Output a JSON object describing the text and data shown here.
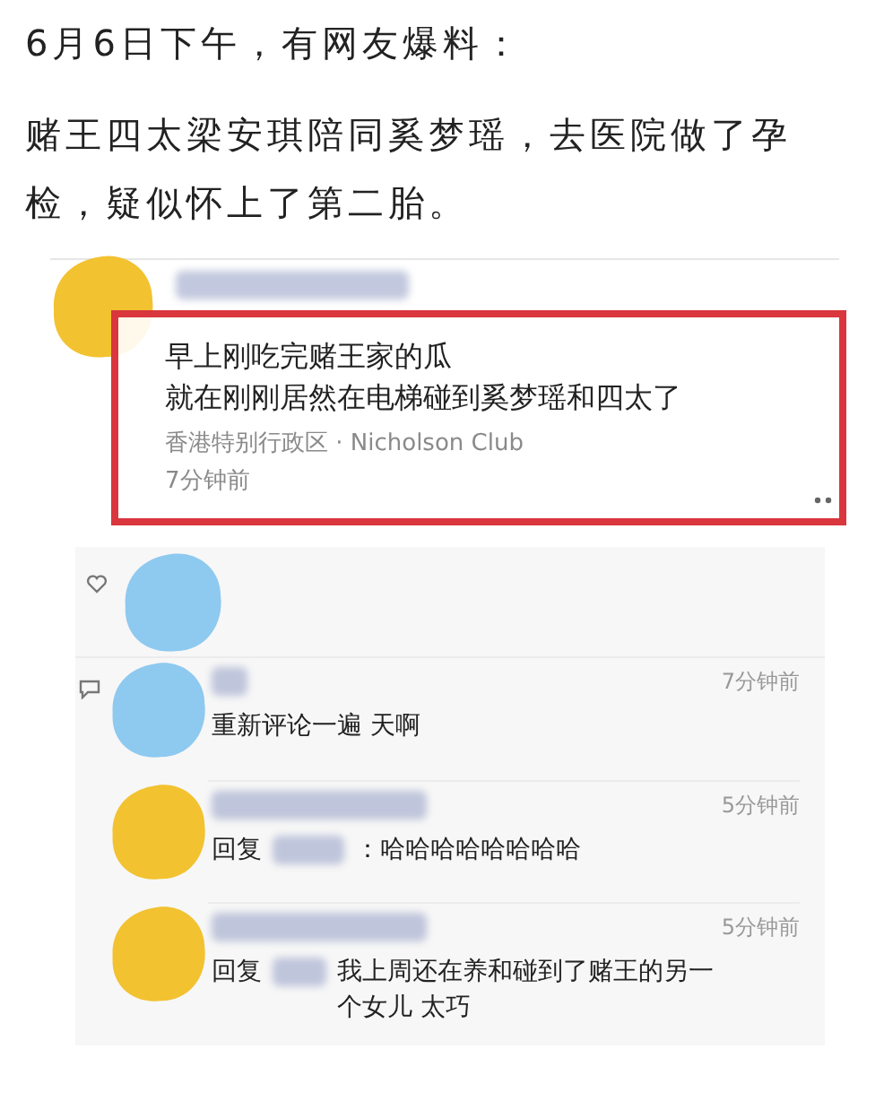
{
  "article": {
    "lines": [
      "6月6日下午，有网友爆料：",
      "赌王四太梁安琪陪同奚梦瑶，去医院做了孕检，疑似怀上了第二胎。"
    ]
  },
  "post": {
    "text_lines": [
      "早上刚吃完赌王家的瓜",
      "就在刚刚居然在电梯碰到奚梦瑶和四太了"
    ],
    "location": "香港特别行政区 · Nicholson Club",
    "time": "7分钟前"
  },
  "comments": [
    {
      "kind": "comment",
      "color": "#8ec9f0",
      "text": "重新评论一遍 天啊",
      "time": "7分钟前"
    },
    {
      "kind": "reply",
      "color": "#f2c230",
      "reply_label": "回复",
      "text": "：哈哈哈哈哈哈哈哈",
      "time": "5分钟前"
    },
    {
      "kind": "reply",
      "color": "#f2c230",
      "reply_label": "回复",
      "text": "我上周还在养和碰到了赌王的另一个女儿 太巧",
      "time": "5分钟前"
    }
  ]
}
